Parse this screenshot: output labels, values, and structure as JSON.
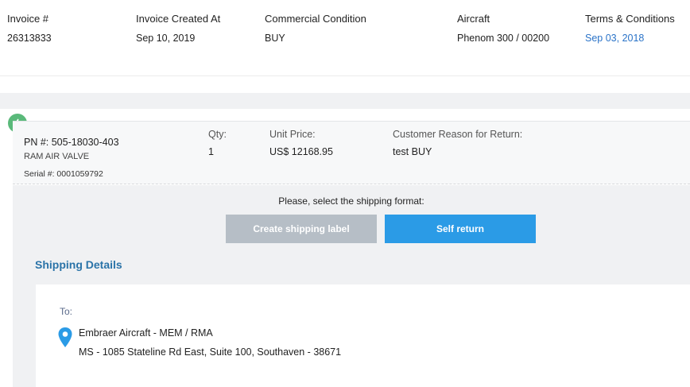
{
  "invoice": {
    "invoice_no_label": "Invoice #",
    "invoice_no": "26313833",
    "created_label": "Invoice Created At",
    "created_at": "Sep 10, 2019",
    "condition_label": "Commercial Condition",
    "condition": "BUY",
    "aircraft_label": "Aircraft",
    "aircraft": "Phenom 300 / 00200",
    "terms_label": "Terms & Conditions",
    "terms_date": "Sep 03, 2018"
  },
  "item": {
    "status_icon": "thumbs-up-icon",
    "status_color": "#5ab97a",
    "pn": "PN #: 505-18030-403",
    "name": "RAM AIR VALVE",
    "serial": "Serial #: 0001059792",
    "qty_label": "Qty:",
    "qty": "1",
    "price_label": "Unit Price:",
    "price": "US$ 12168.95",
    "reason_label": "Customer Reason for Return:",
    "reason": "test BUY"
  },
  "shipping": {
    "prompt": "Please, select the shipping format:",
    "create_label_button": "Create shipping label",
    "self_return_button": "Self return",
    "details_title": "Shipping Details",
    "to_label": "To:",
    "address_name": "Embraer Aircraft - MEM / RMA",
    "address_line": "MS - 1085 Stateline Rd East, Suite 100, Southaven - 38671",
    "pin_icon": "location-pin-icon"
  },
  "colors": {
    "accent": "#2b9be6",
    "link": "#2a73c8",
    "disabled": "#b6bec6",
    "title": "#2a73a8"
  }
}
